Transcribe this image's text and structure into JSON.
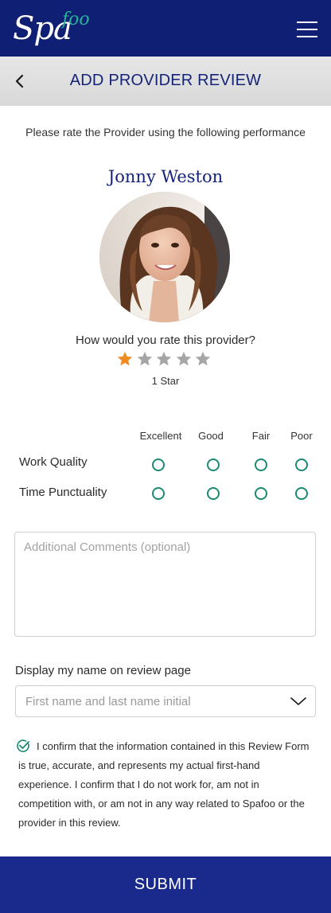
{
  "header": {
    "logo_main": "Spa",
    "logo_accent": "foo",
    "brand_color": "#0f1f73",
    "accent_color": "#24b39a",
    "menu_icon": "hamburger-menu-icon"
  },
  "titlebar": {
    "back_icon": "chevron-left-icon",
    "title": "ADD PROVIDER REVIEW"
  },
  "intro": "Please rate the Provider using the following performance",
  "provider": {
    "name": "Jonny Weston"
  },
  "rating": {
    "question": "How would you rate this provider?",
    "max_stars": 5,
    "selected_stars": 1,
    "caption": "1 Star",
    "filled_color": "#f08a1e",
    "empty_color": "#a6a6a6"
  },
  "performance": {
    "columns": [
      "Excellent",
      "Good",
      "Fair",
      "Poor"
    ],
    "rows": [
      {
        "label": "Work Quality"
      },
      {
        "label": "Time Punctuality"
      }
    ],
    "radio_color": "#1b8a73"
  },
  "comments": {
    "placeholder": "Additional Comments (optional)",
    "value": ""
  },
  "display_name": {
    "label": "Display my name on review page",
    "selected": "First name and last name initial"
  },
  "confirmation": {
    "checked": true,
    "text": "I confirm that the information contained in this Review Form is true, accurate, and represents my actual first-hand experience. I confirm that I do not work for, am not in competition with, or am not in any way related to Spafoo or the provider in this review."
  },
  "submit_label": "SUBMIT",
  "submit_color": "#1a2a8c"
}
